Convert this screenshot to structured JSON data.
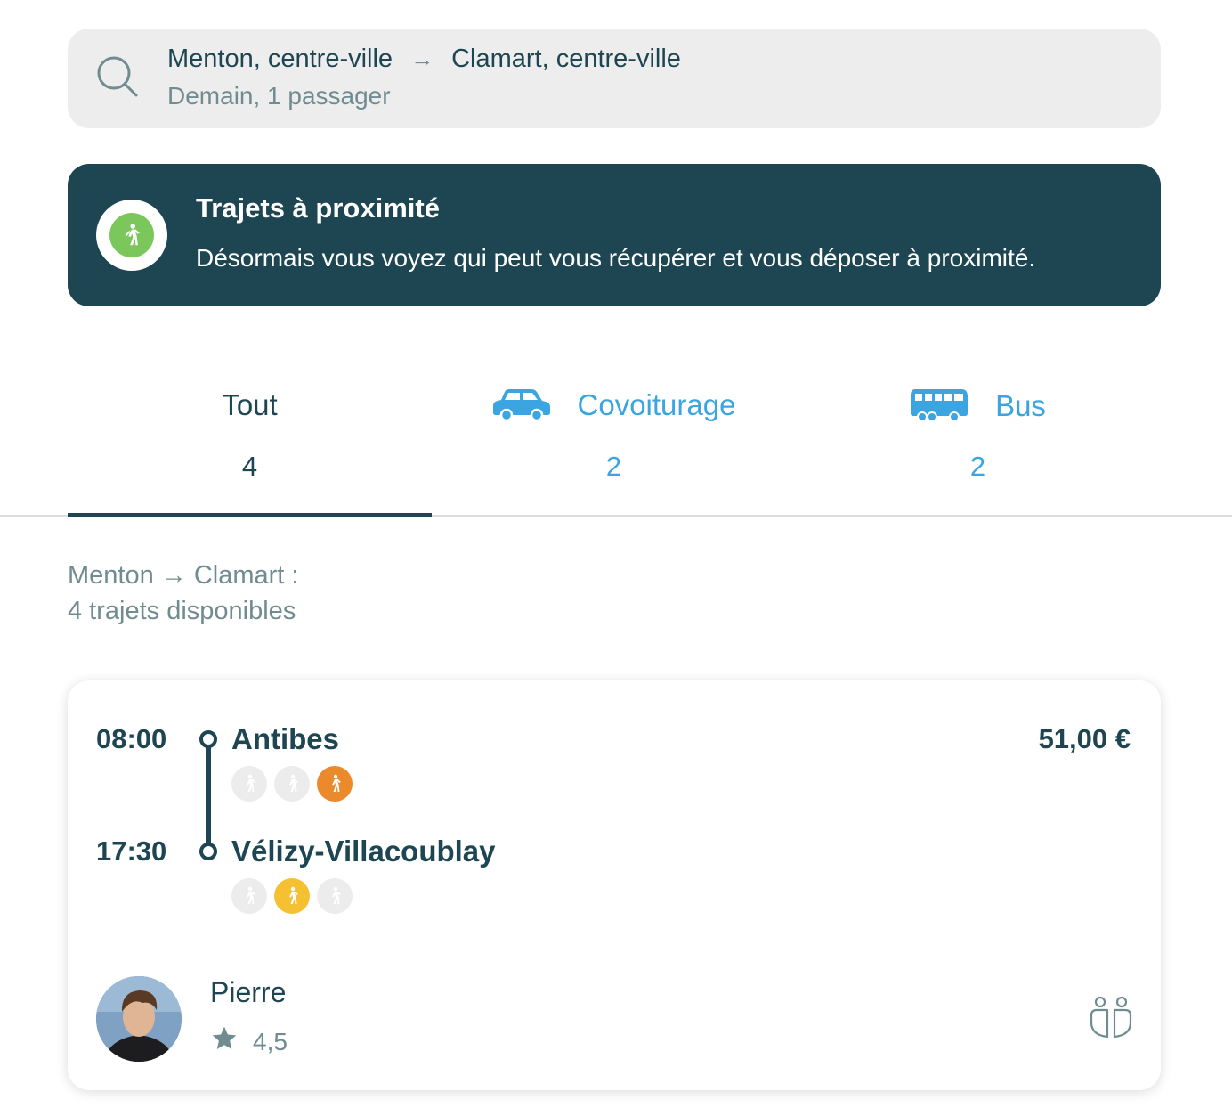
{
  "search": {
    "from": "Menton, centre-ville",
    "arrow": "→",
    "to": "Clamart, centre-ville",
    "details": "Demain, 1 passager"
  },
  "banner": {
    "title": "Trajets à proximité",
    "text": "Désormais vous voyez qui peut vous récupérer et vous déposer à proximité."
  },
  "tabs": [
    {
      "label": "Tout",
      "count": "4",
      "active": true
    },
    {
      "label": "Covoiturage",
      "count": "2",
      "icon": "car-icon"
    },
    {
      "label": "Bus",
      "count": "2",
      "icon": "bus-icon"
    }
  ],
  "results": {
    "route": "Menton → Clamart :",
    "count": "4 trajets disponibles"
  },
  "trip": {
    "departure_time": "08:00",
    "departure_place": "Antibes",
    "departure_proximity": 3,
    "arrival_time": "17:30",
    "arrival_place": "Vélizy-Villacoublay",
    "arrival_proximity": 2,
    "price": "51,00 €",
    "driver": {
      "name": "Pierre",
      "rating": "4,5"
    }
  },
  "colors": {
    "primary": "#1e4652",
    "accent": "#3aa5e0",
    "muted": "#708c91",
    "proximity_green": "#7cc75c",
    "proximity_orange": "#ea8a2c",
    "proximity_yellow": "#f5c132"
  }
}
